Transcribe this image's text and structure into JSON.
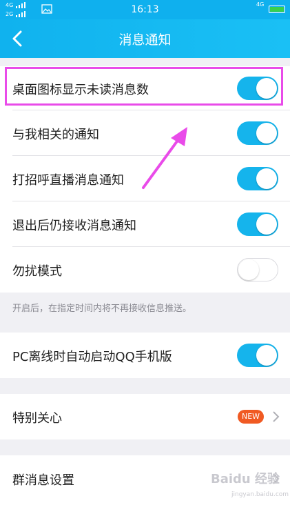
{
  "status": {
    "signal_top": "4G",
    "signal_bottom": "2G",
    "time": "16:13",
    "network": "4G"
  },
  "navbar": {
    "title": "消息通知"
  },
  "settings": [
    {
      "label": "桌面图标显示未读消息数",
      "state": "on"
    },
    {
      "label": "与我相关的通知",
      "state": "on"
    },
    {
      "label": "打招呼直播消息通知",
      "state": "on"
    },
    {
      "label": "退出后仍接收消息通知",
      "state": "on"
    },
    {
      "label": "勿扰模式",
      "state": "off"
    }
  ],
  "dnd_hint": "开启后，在指定时间内将不再接收信息推送。",
  "pc_offline": {
    "label": "PC离线时自动启动QQ手机版",
    "state": "on"
  },
  "special_care": {
    "label": "特别关心",
    "badge": "NEW"
  },
  "group_settings": {
    "label": "群消息设置"
  },
  "watermark": {
    "brand": "Baidu 经验",
    "url": "jingyan.baidu.com"
  },
  "colors": {
    "accent": "#15b4ec",
    "highlight": "#e94be9",
    "badge": "#f05a23"
  }
}
